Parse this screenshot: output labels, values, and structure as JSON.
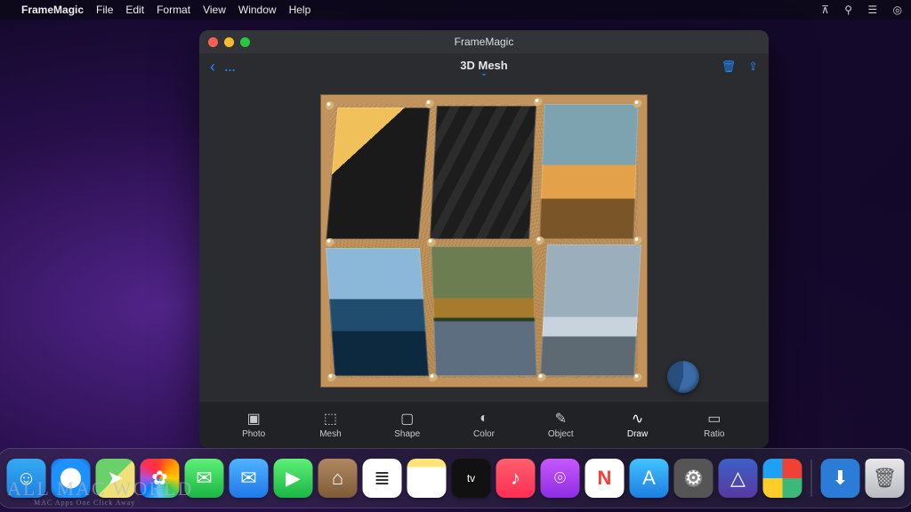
{
  "menubar": {
    "app_name": "FrameMagic",
    "items": [
      "File",
      "Edit",
      "Format",
      "View",
      "Window",
      "Help"
    ]
  },
  "window": {
    "title": "FrameMagic",
    "mode_title": "3D Mesh"
  },
  "bottom_tools": [
    {
      "name": "photo",
      "label": "Photo"
    },
    {
      "name": "mesh",
      "label": "Mesh"
    },
    {
      "name": "shape",
      "label": "Shape"
    },
    {
      "name": "color",
      "label": "Color"
    },
    {
      "name": "object",
      "label": "Object"
    },
    {
      "name": "draw",
      "label": "Draw"
    },
    {
      "name": "ratio",
      "label": "Ratio"
    }
  ],
  "dock": [
    {
      "name": "finder",
      "bg": "linear-gradient(#34aaf1,#1f7fe0)"
    },
    {
      "name": "safari",
      "bg": "radial-gradient(circle,#fff 0 36%,#1e90ff 38% 70%,#0b5fb0 100%)"
    },
    {
      "name": "maps",
      "bg": "linear-gradient(135deg,#6ad06a 0 50%,#f0e079 50% 100%)"
    },
    {
      "name": "photos",
      "bg": "conic-gradient(#ff3b30,#ff9500,#ffcc00,#34c759,#5ac8fa,#007aff,#af52de,#ff2d55,#ff3b30)"
    },
    {
      "name": "messages",
      "bg": "linear-gradient(#5ef077,#1bb644)"
    },
    {
      "name": "mail",
      "bg": "linear-gradient(#4fb4ff,#1f78e8)"
    },
    {
      "name": "facetime",
      "bg": "linear-gradient(#5ef077,#1bb644)"
    },
    {
      "name": "contacts",
      "bg": "linear-gradient(#b08860,#7d5b38)"
    },
    {
      "name": "reminders",
      "bg": "#ffffff"
    },
    {
      "name": "notes",
      "bg": "linear-gradient(#ffe477 0 22%,#fff 22%)"
    },
    {
      "name": "tv",
      "bg": "#111111"
    },
    {
      "name": "music",
      "bg": "linear-gradient(#ff5f6d,#ff2d55)"
    },
    {
      "name": "podcasts",
      "bg": "linear-gradient(#c658ff,#8e2de2)"
    },
    {
      "name": "news",
      "bg": "#ffffff"
    },
    {
      "name": "appstore",
      "bg": "linear-gradient(#42c3ff,#1e7de0)"
    },
    {
      "name": "settings",
      "bg": "radial-gradient(circle,#888 0 30%,#555 32% 100%)"
    },
    {
      "name": "freeform",
      "bg": "linear-gradient(#3e5fc8,#5639a0)"
    },
    {
      "name": "framemagic",
      "bg": "conic-gradient(#ef4136 0 25%,#3cb878 25% 50%,#ffcc29 50% 75%,#1ea1f2 75% 100%)"
    }
  ],
  "dock_right": [
    {
      "name": "downloads",
      "bg": "#2a7cd7"
    },
    {
      "name": "trash",
      "bg": "linear-gradient(#e8e8ea,#b9bbc0)"
    }
  ],
  "watermark": {
    "line1": "ALL MAC WORLD",
    "line2": "MAC Apps One Click Away"
  },
  "colors": {
    "accent": "#1e88ff"
  }
}
